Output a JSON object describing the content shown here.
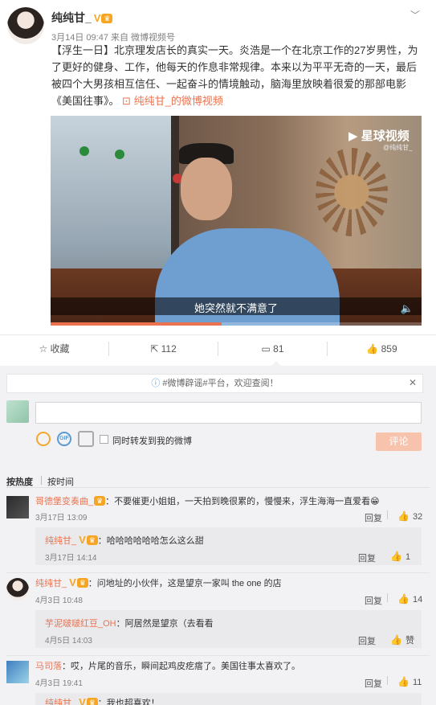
{
  "post": {
    "author": "纯纯甘_",
    "verified_badge": "V",
    "meta": "3月14日 09:47 来自 微博视频号",
    "text": "【浮生一日】北京理发店长的真实一天。炎浩是一个在北京工作的27岁男性，为了更好的健身、工作，他每天的作息非常规律。本来以为平平无奇的一天，最后被四个大男孩相互信任、一起奋斗的情境触动，脑海里放映着很爱的那部电影《美国往事》。",
    "video_link_icon": "video-icon",
    "video_link": "纯纯甘_的微博视频"
  },
  "video": {
    "brand": "星球视频",
    "brand_sub": "@纯纯甘_",
    "subtitle": "她突然就不满意了",
    "progress": 0.46
  },
  "actions": {
    "favorite": "收藏",
    "repost": "112",
    "comment": "81",
    "like": "859"
  },
  "notice": "#微博辟谣#平台，欢迎查阅！",
  "compose": {
    "placeholder": "",
    "also_repost": "同时转发到我的微博",
    "submit": "评论"
  },
  "sort": {
    "hot": "按热度",
    "time": "按时间"
  },
  "comments": [
    {
      "name": "哥德堡变奏曲_",
      "text": "：不要催更小姐姐，一天拍到晚很累的，慢慢来，浮生海海一直爱看",
      "time": "3月17日 13:09",
      "reply_label": "回复",
      "likes": "32",
      "reply": {
        "name": "纯纯甘_",
        "text": "：哈哈哈哈哈哈怎么这么甜",
        "time": "3月17日 14:14",
        "reply_label": "回复",
        "likes": "1"
      }
    },
    {
      "name": "纯纯甘_",
      "text": "：问地址的小伙伴，这是望京一家叫 the one 的店",
      "time": "4月3日 10:48",
      "reply_label": "回复",
      "likes": "14",
      "reply": {
        "name": "芋泥啵啵红豆_OH",
        "text": "：阿居然是望京（去看看",
        "time": "4月5日 14:03",
        "reply_label": "回复",
        "likes": "赞"
      }
    },
    {
      "name": "马司落",
      "text": "：哎，片尾的音乐，瞬间起鸡皮疙瘩了。美国往事太喜欢了。",
      "time": "4月3日 19:41",
      "reply_label": "回复",
      "likes": "11",
      "reply": {
        "name": "纯纯甘_",
        "text": "：我也超喜欢！"
      }
    }
  ],
  "colors": {
    "accent": "#eb7350",
    "badge": "#f6a623",
    "comment_bg": "#f2f2f5",
    "submit_disabled": "#f7c3ac"
  }
}
